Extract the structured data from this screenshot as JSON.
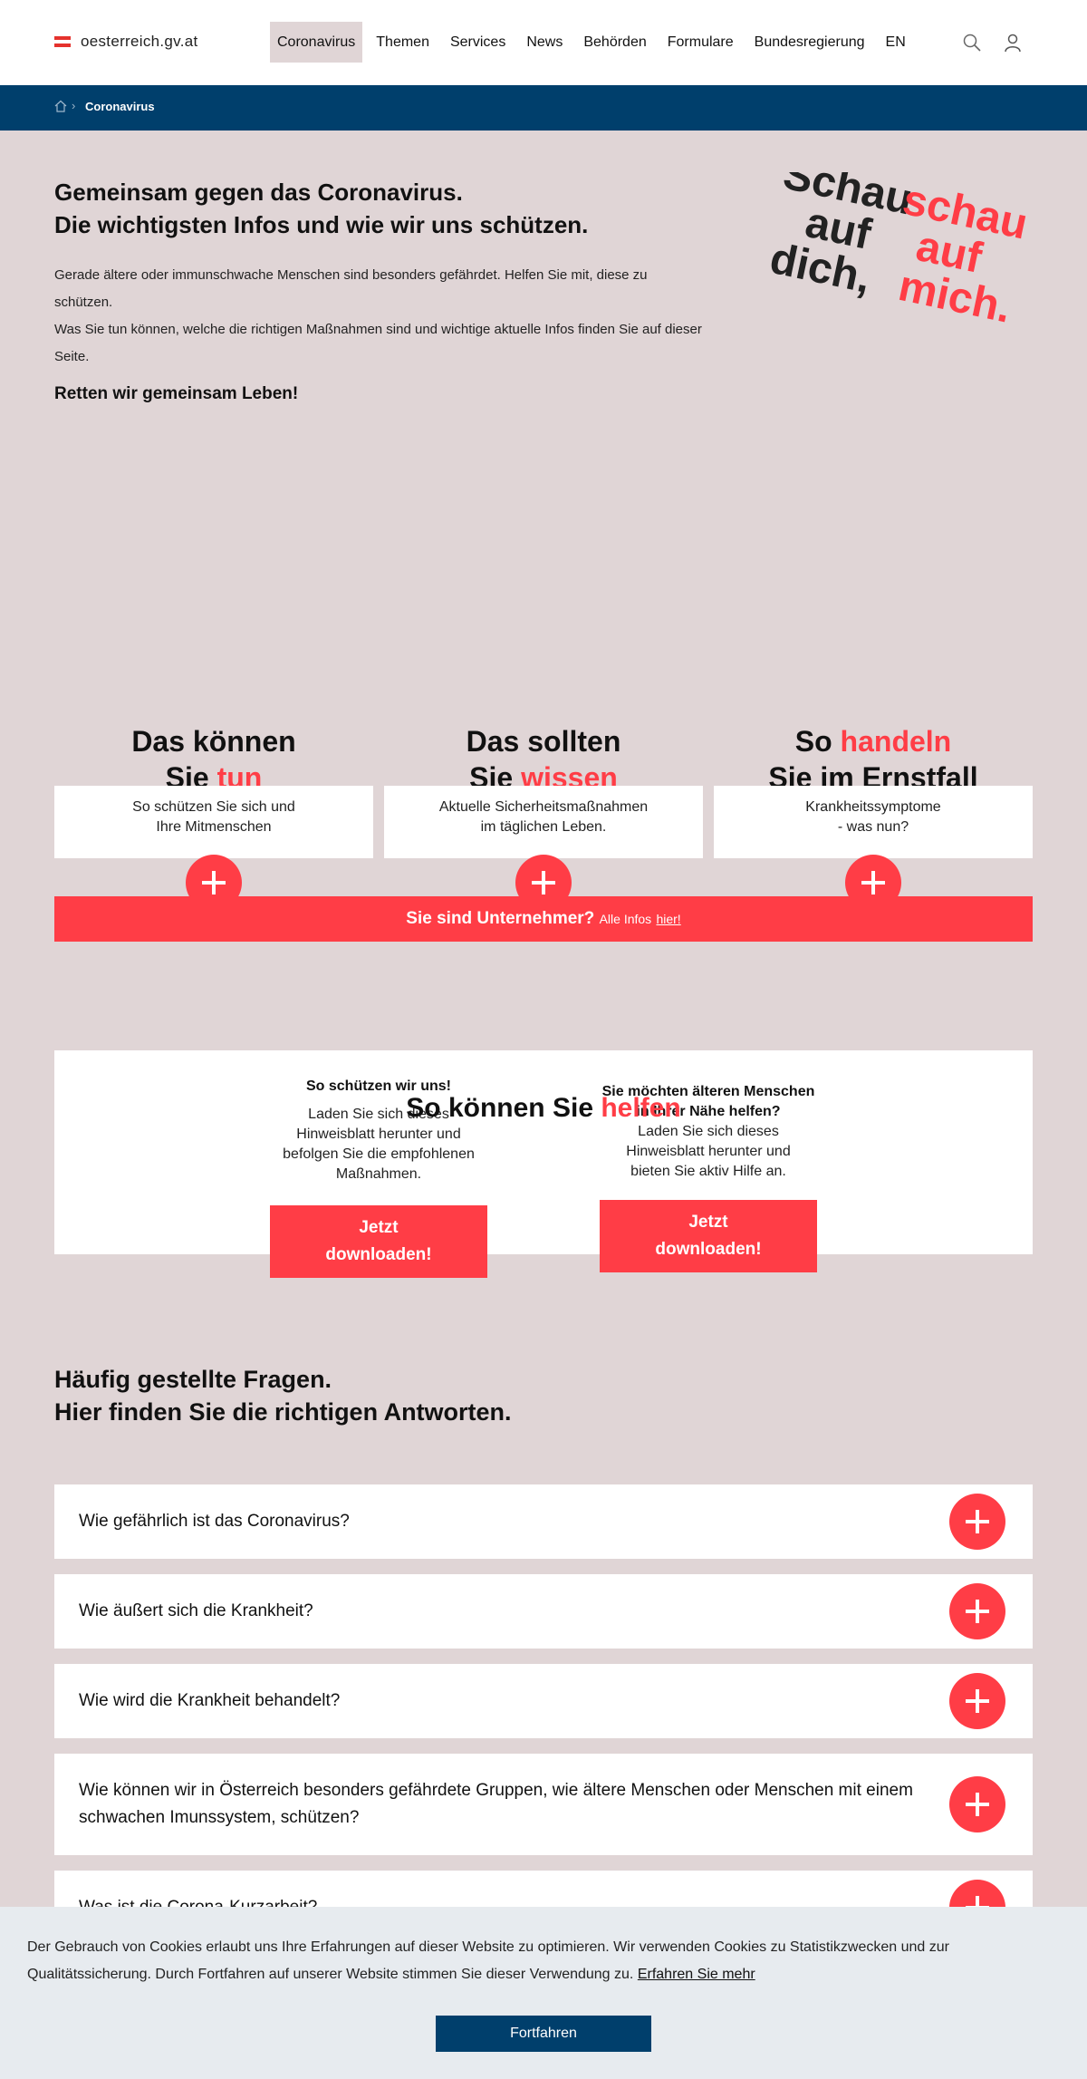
{
  "header": {
    "logo_text": "oesterreich.gv.at",
    "nav": [
      "Coronavirus",
      "Themen",
      "Services",
      "News",
      "Behörden",
      "Formulare",
      "Bundesregierung",
      "EN"
    ]
  },
  "breadcrumb": {
    "current": "Coronavirus"
  },
  "intro": {
    "title_line1": "Gemeinsam gegen das Coronavirus.",
    "title_line2": "Die wichtigsten Infos und wie wir uns schützen.",
    "text_line1": "Gerade ältere oder immunschwache Menschen sind besonders gefährdet. Helfen Sie mit, diese zu schützen.",
    "text_line2": "Was Sie tun können, welche die richtigen Maßnahmen sind und wichtige aktuelle Infos finden Sie auf dieser Seite.",
    "strong": "Retten wir gemeinsam Leben!"
  },
  "slogan": {
    "dark": [
      "Schau",
      "auf",
      "dich,"
    ],
    "red": [
      "schau",
      "auf",
      "mich."
    ]
  },
  "cards": [
    {
      "title_a": "Das können",
      "title_b": "Sie ",
      "highlight": "tun",
      "title_c": "",
      "desc1": "So schützen Sie sich und",
      "desc2": "Ihre Mitmenschen"
    },
    {
      "title_a": "Das sollten",
      "title_b": "Sie ",
      "highlight": "wissen",
      "title_c": "",
      "desc1": "Aktuelle Sicherheitsmaßnahmen",
      "desc2": "im täglichen Leben."
    },
    {
      "title_a": "So ",
      "title_b": "Sie im Ernstfall",
      "highlight": "handeln",
      "title_c": "",
      "desc1": "Krankheitssymptome",
      "desc2": "- was nun?"
    }
  ],
  "banner": {
    "strong": "Sie sind Unternehmer?",
    "text": "Alle Infos",
    "link": "hier!"
  },
  "help": {
    "title": "So können Sie ",
    "highlight": "helfen",
    "col1": {
      "title": "So schützen wir uns!",
      "desc": [
        "Laden Sie sich dieses",
        "Hinweisblatt herunter und",
        "befolgen Sie die empfohlenen",
        "Maßnahmen."
      ],
      "button": [
        "Jetzt",
        "downloaden!"
      ]
    },
    "col2": {
      "title": [
        "Sie möchten älteren Menschen",
        "in Ihrer Nähe helfen?"
      ],
      "desc": [
        "Laden Sie sich dieses",
        "Hinweisblatt herunter und",
        "bieten Sie aktiv Hilfe an."
      ],
      "button": [
        "Jetzt",
        "downloaden!"
      ]
    }
  },
  "faq": {
    "title_line1": "Häufig gestellte Fragen.",
    "title_line2": "Hier finden Sie die richtigen Antworten.",
    "items": [
      "Wie gefährlich ist das Coronavirus?",
      "Wie äußert sich die Krankheit?",
      "Wie wird die Krankheit behandelt?",
      "Wie können wir in Österreich besonders gefährdete Gruppen, wie ältere Menschen oder Menschen mit einem schwachen Imunssystem, schützen?",
      "Was ist die Corona-Kurzarbeit?"
    ]
  },
  "cookie": {
    "text_line1": "Der Gebrauch von Cookies erlaubt uns Ihre Erfahrungen auf dieser Website zu optimieren. Wir verwenden Cookies zu Statistikzwecken und zur",
    "text_line2": "Qualitätssicherung. Durch Fortfahren auf unserer Website stimmen Sie dieser Verwendung zu.",
    "link": "Erfahren Sie mehr",
    "button": "Fortfahren"
  },
  "colors": {
    "accent": "#ff3d46",
    "navy": "#003f6c",
    "background": "#e0d5d6"
  }
}
